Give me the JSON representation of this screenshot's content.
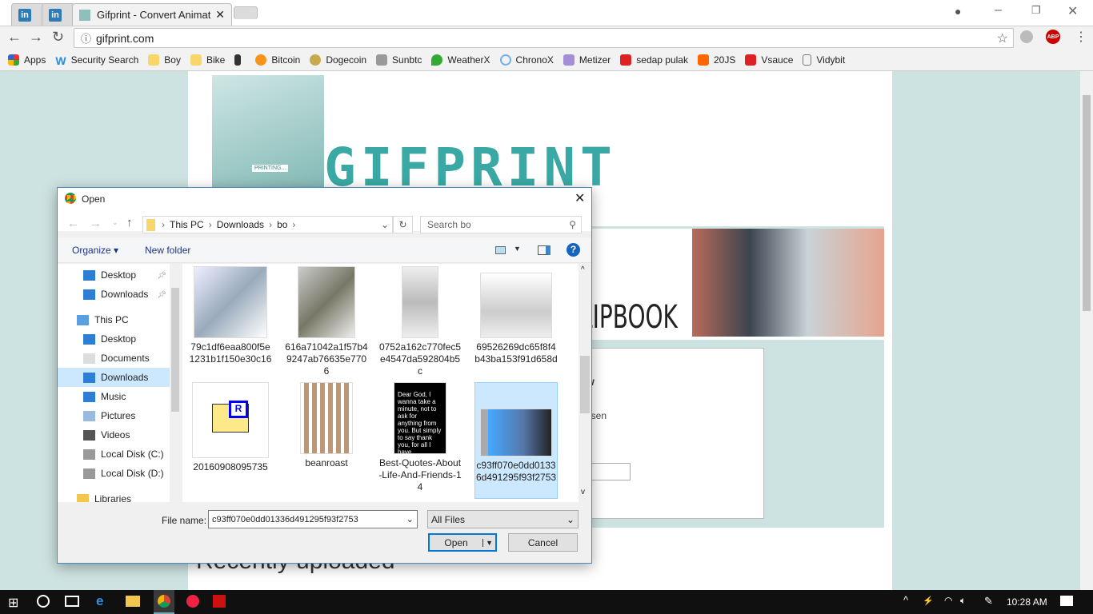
{
  "browser": {
    "tabs": [
      {
        "label": "in"
      },
      {
        "label": "in"
      },
      {
        "label": "Gifprint - Convert Animat"
      }
    ],
    "url": "gifprint.com",
    "bookmarks": [
      "Apps",
      "Security Search",
      "Boy",
      "Bike",
      "",
      "Bitcoin",
      "Dogecoin",
      "Sunbtc",
      "WeatherX",
      "ChronoX",
      "Metizer",
      "sedap pulak",
      "20JS",
      "Vsauce",
      "Vidybit"
    ],
    "extension_label": "ABP"
  },
  "page": {
    "logo_text": "GIFPRINT",
    "logo_badge": "PRINTING...",
    "headline_fragment": "LIPBOOK",
    "box_heading_fragment": "w",
    "box_text_fragment": "osen",
    "recent_heading": "Recently uploaded"
  },
  "dialog": {
    "title": "Open",
    "breadcrumb": [
      "This PC",
      "Downloads",
      "bo"
    ],
    "search_placeholder": "Search bo",
    "organize": "Organize ▾",
    "new_folder": "New folder",
    "nav": [
      {
        "label": "Desktop",
        "icon": "desktop-icon",
        "pinned": true
      },
      {
        "label": "Downloads",
        "icon": "download-icon",
        "pinned": true
      },
      {
        "label": "This PC",
        "icon": "computer-icon"
      },
      {
        "label": "Desktop",
        "icon": "desktop-icon"
      },
      {
        "label": "Documents",
        "icon": "documents-icon"
      },
      {
        "label": "Downloads",
        "icon": "download-icon",
        "selected": true
      },
      {
        "label": "Music",
        "icon": "music-icon"
      },
      {
        "label": "Pictures",
        "icon": "pictures-icon"
      },
      {
        "label": "Videos",
        "icon": "videos-icon"
      },
      {
        "label": "Local Disk (C:)",
        "icon": "drive-icon"
      },
      {
        "label": "Local Disk (D:)",
        "icon": "drive-icon"
      },
      {
        "label": "Libraries",
        "icon": "libraries-icon"
      }
    ],
    "files": [
      {
        "name": "79c1df6eaa800f5e1231b1f150e30c16"
      },
      {
        "name": "616a71042a1f57b49247ab76635e7706"
      },
      {
        "name": "0752a162c770fec5e4547da592804b5c"
      },
      {
        "name": "69526269dc65f8f4b43ba153f91d658d"
      },
      {
        "name": "20160908095735"
      },
      {
        "name": "beanroast"
      },
      {
        "name": "Best-Quotes-About-Life-And-Friends-14",
        "thumb_text": "Dear God, I wanna take a minute, not to ask for anything from you. But simply to say thank you, for all I have."
      },
      {
        "name": "c93ff070e0dd01336d491295f93f2753",
        "selected": true
      }
    ],
    "file_name_label": "File name:",
    "file_name_value": "c93ff070e0dd01336d491295f93f2753",
    "file_type": "All Files",
    "open": "Open",
    "cancel": "Cancel"
  },
  "taskbar": {
    "time": "10:28 AM"
  },
  "colors": {
    "accent": "#3aa9a5",
    "selection": "#cce8ff",
    "page_bg": "#cde3e1"
  }
}
